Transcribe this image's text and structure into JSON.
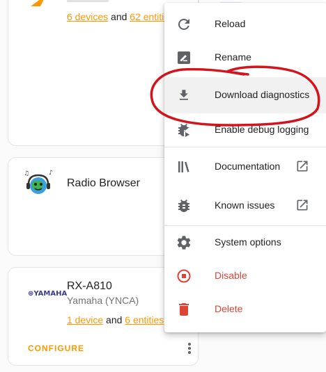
{
  "colors": {
    "accent": "#ff9800",
    "danger": "#db4437",
    "annotation": "#d4141c"
  },
  "cards": [
    {
      "name": "",
      "devices_link": "6 devices",
      "joiner": "and",
      "entities_link": "62 entities"
    },
    {
      "name": "Radio Browser"
    },
    {
      "name": "RX-A810",
      "manufacturer": "Yamaha (YNCA)",
      "logo_text": "⊛YAMAHA",
      "devices_link": "1 device",
      "joiner": "and",
      "entities_link": "6 entities",
      "configure_label": "CONFIGURE"
    }
  ],
  "menu": {
    "items": [
      {
        "label": "Reload",
        "icon": "reload-icon"
      },
      {
        "label": "Rename",
        "icon": "rename-icon"
      },
      {
        "label": "Download diagnostics",
        "icon": "download-icon"
      },
      {
        "label": "Enable debug logging",
        "icon": "bug-play-icon"
      },
      {
        "label": "Documentation",
        "icon": "library-icon"
      },
      {
        "label": "Known issues",
        "icon": "bug-icon"
      },
      {
        "label": "System options",
        "icon": "gear-icon"
      },
      {
        "label": "Disable",
        "icon": "stop-circle-icon"
      },
      {
        "label": "Delete",
        "icon": "trash-icon"
      }
    ]
  }
}
